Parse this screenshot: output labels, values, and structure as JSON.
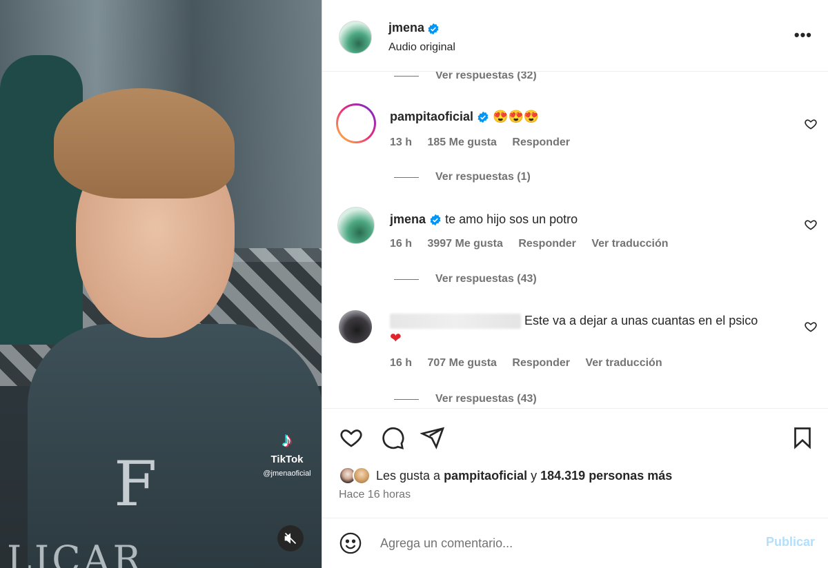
{
  "media": {
    "watermark": {
      "brand": "TikTok",
      "handle": "@jmenaoficial"
    },
    "cape_letter": "F",
    "cape_text": "LICAR",
    "mute_icon": "speaker-muted-icon"
  },
  "header": {
    "username": "jmena",
    "subtitle": "Audio original",
    "more_icon": "•••"
  },
  "comments": [
    {
      "type": "replies",
      "label": "Ver respuestas (32)"
    },
    {
      "username": "pampitaoficial",
      "verified": true,
      "text": "😍😍😍",
      "time": "13 h",
      "likes": "185 Me gusta",
      "reply": "Responder",
      "replies": "Ver respuestas (1)"
    },
    {
      "username": "jmena",
      "verified": true,
      "text": "te amo hijo sos un potro",
      "time": "16 h",
      "likes": "3997 Me gusta",
      "reply": "Responder",
      "translate": "Ver traducción",
      "replies": "Ver respuestas (43)"
    },
    {
      "username": "",
      "verified": false,
      "text": "Este va a dejar a unas cuantas en el psico",
      "text2": "❤",
      "time": "16 h",
      "likes": "707 Me gusta",
      "reply": "Responder",
      "translate": "Ver traducción",
      "replies": "Ver respuestas (43)"
    }
  ],
  "likes": {
    "prefix": "Les gusta a ",
    "user": "pampitaoficial",
    "middle": " y ",
    "count": "184.319 personas más"
  },
  "time_ago": "Hace 16 horas",
  "add_comment": {
    "placeholder": "Agrega un comentario...",
    "publish": "Publicar"
  },
  "colors": {
    "verified": "#0095f6",
    "muted_text": "#737373",
    "publish_disabled": "#b2dffc"
  }
}
